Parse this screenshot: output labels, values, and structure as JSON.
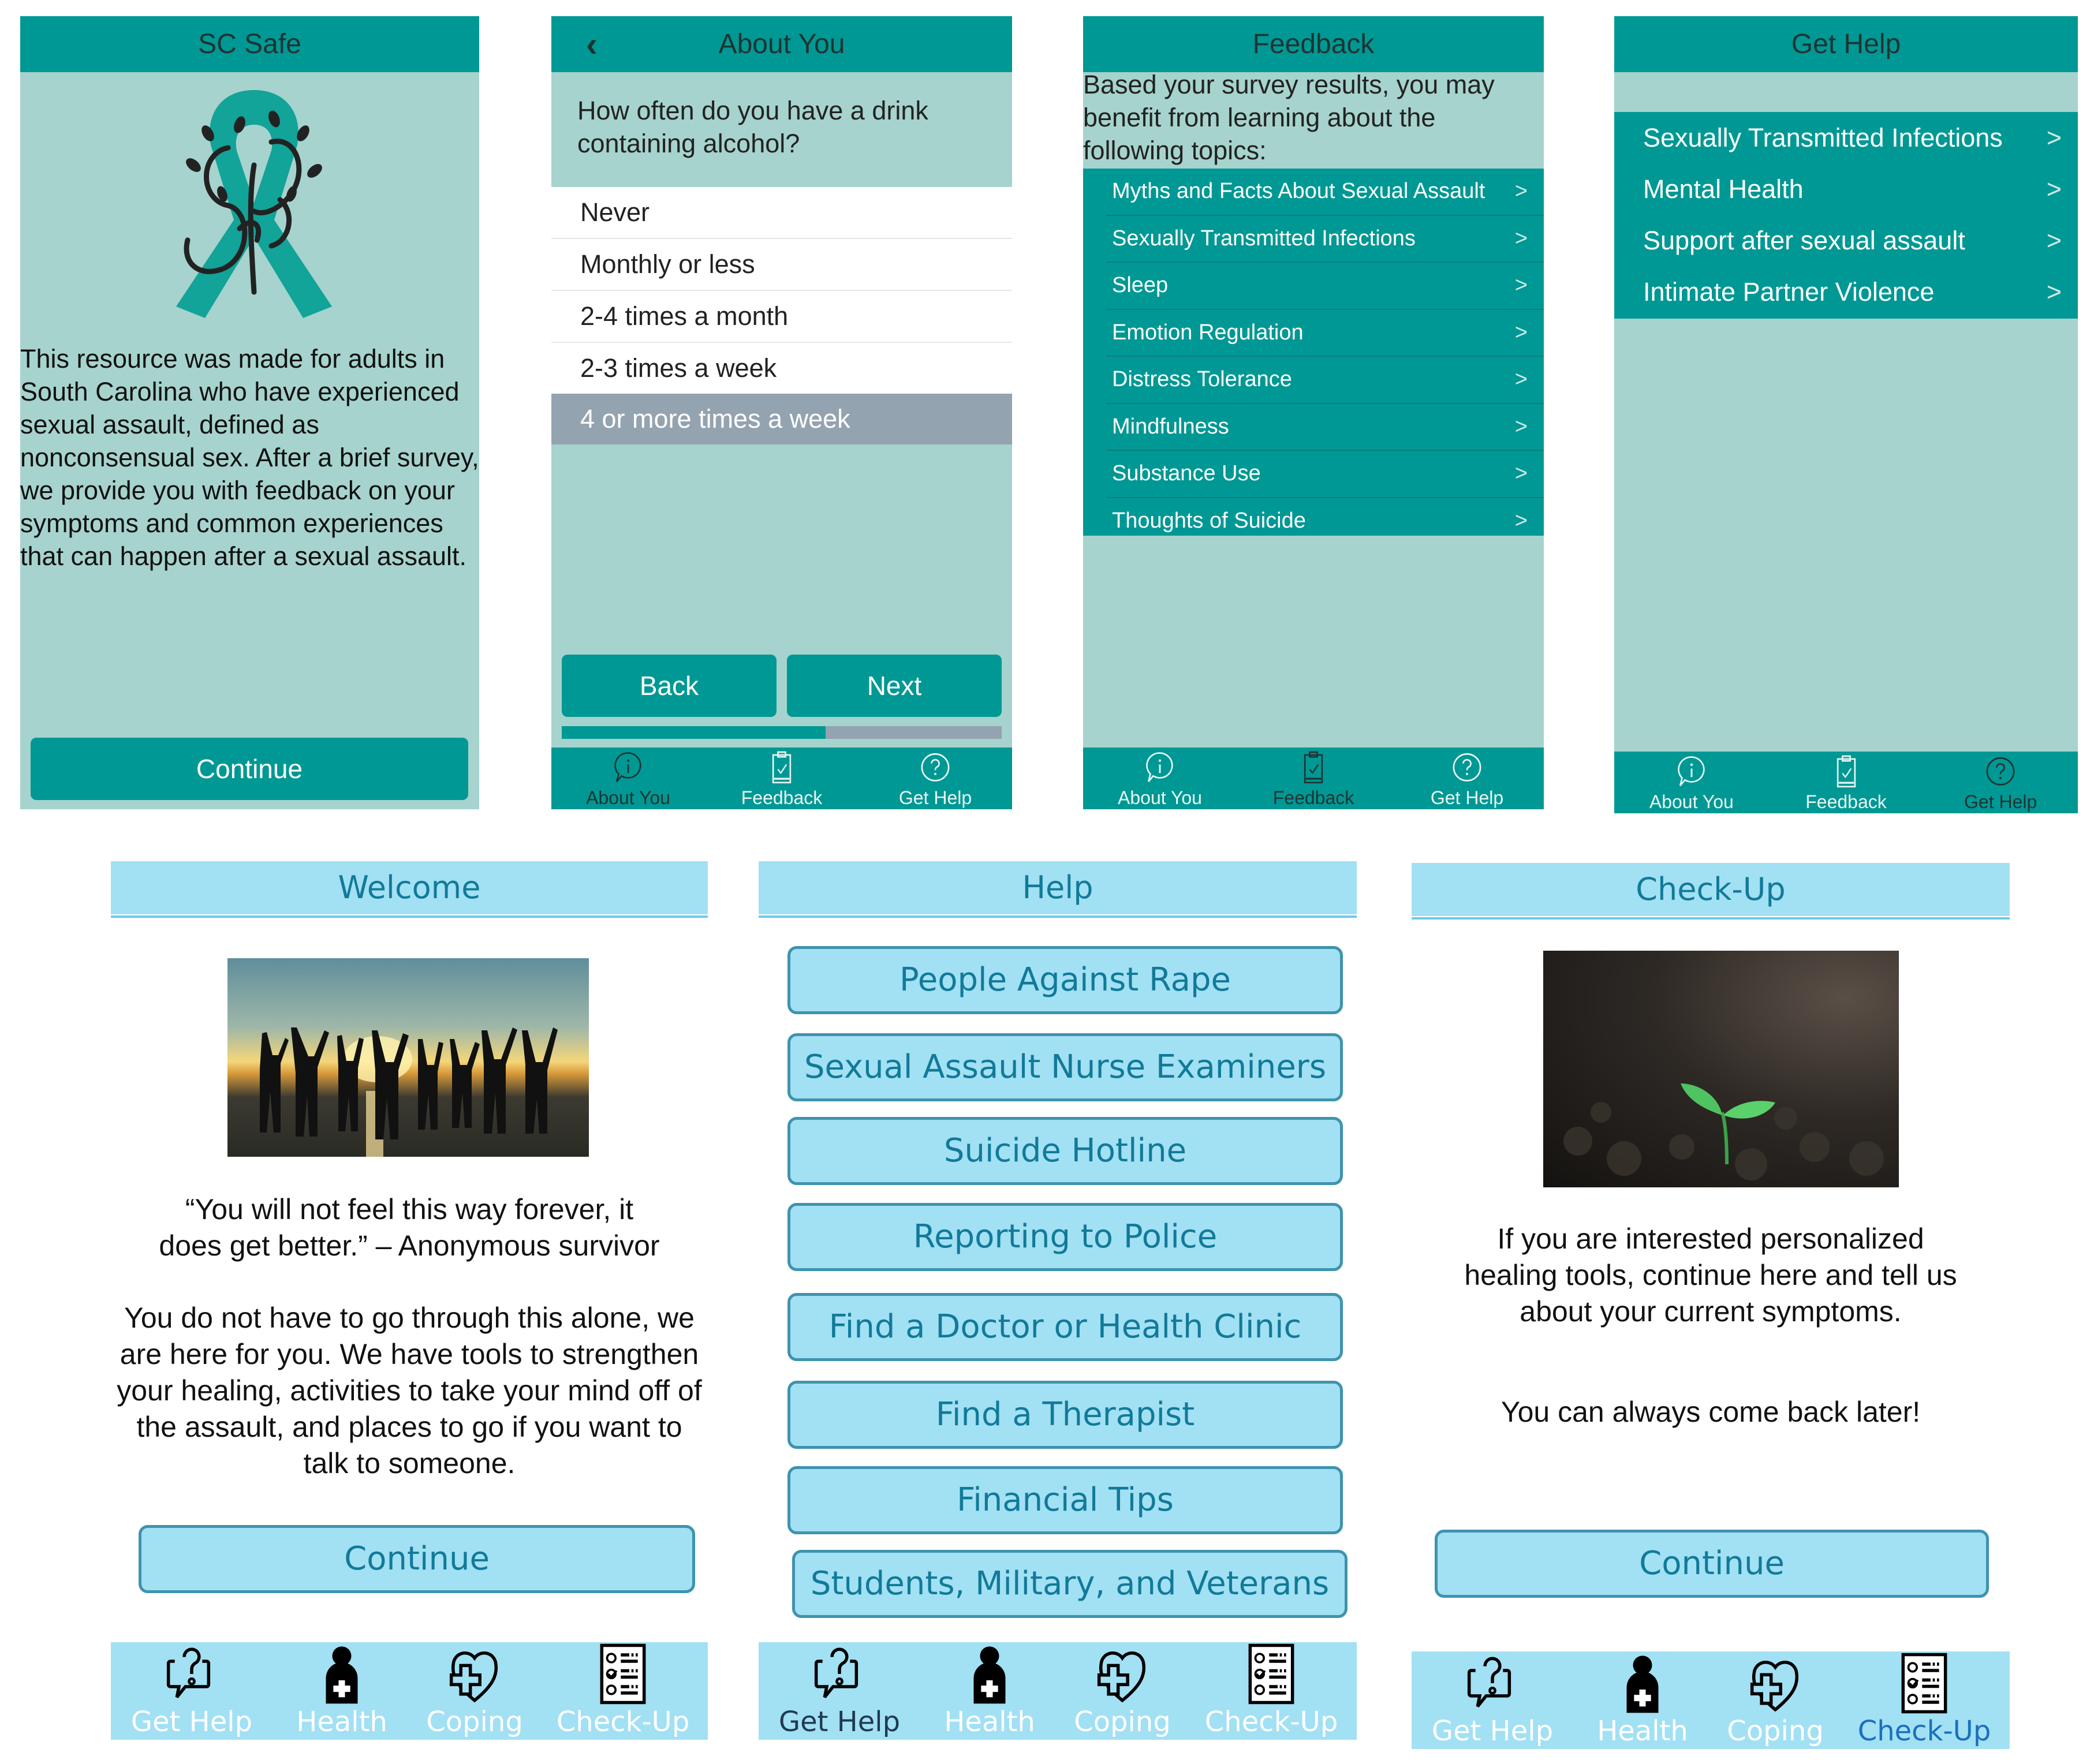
{
  "colors": {
    "teal_primary": "#009894",
    "teal_light_bg": "#a6d3cd",
    "selected_row": "#94a3b0",
    "progress_track": "#94a3b0",
    "blue_light": "#a2e0f4",
    "blue_text": "#117a98",
    "blue_border": "#3f93ae",
    "active_tab_dark": "#1e3432",
    "active_tab_blue": "#1a6fbd"
  },
  "sc_safe_screen": {
    "title": "SC Safe",
    "logo": "teal-ribbon-safe-logo",
    "description": "This resource was made for adults in South Carolina who have experienced sexual assault, defined as nonconsensual sex. After a brief survey, we provide you with feedback on your symptoms and common experiences that can happen after a sexual assault.",
    "continue_label": "Continue"
  },
  "about_you_screen": {
    "title": "About You",
    "back_icon": "chevron-left-icon",
    "question": "How often do you have a drink containing alcohol?",
    "options": [
      {
        "label": "Never",
        "selected": false
      },
      {
        "label": "Monthly or less",
        "selected": false
      },
      {
        "label": "2-4 times a month",
        "selected": false
      },
      {
        "label": "2-3 times a week",
        "selected": false
      },
      {
        "label": "4 or more times a week",
        "selected": true
      }
    ],
    "back_label": "Back",
    "next_label": "Next",
    "progress": 0.6,
    "tabs": [
      {
        "label": "About You",
        "icon": "info-bubble-icon",
        "active": true
      },
      {
        "label": "Feedback",
        "icon": "clipboard-check-icon",
        "active": false
      },
      {
        "label": "Get Help",
        "icon": "question-circle-icon",
        "active": false
      }
    ]
  },
  "feedback_screen": {
    "title": "Feedback",
    "intro": "Based your survey results, you may benefit from learning about the following topics:",
    "topics": [
      "Myths and Facts About Sexual Assault",
      "Sexually Transmitted Infections",
      "Sleep",
      "Emotion Regulation",
      "Distress Tolerance",
      "Mindfulness",
      "Substance Use",
      "Thoughts of Suicide"
    ],
    "chevron": ">",
    "tabs": [
      {
        "label": "About You",
        "icon": "info-bubble-icon",
        "active": false
      },
      {
        "label": "Feedback",
        "icon": "clipboard-check-icon",
        "active": true
      },
      {
        "label": "Get Help",
        "icon": "question-circle-icon",
        "active": false
      }
    ]
  },
  "get_help_screen": {
    "title": "Get Help",
    "items": [
      "Sexually Transmitted Infections",
      "Mental Health",
      "Support after sexual assault",
      "Intimate Partner Violence"
    ],
    "chevron": ">",
    "tabs": [
      {
        "label": "About You",
        "icon": "info-bubble-icon",
        "active": false
      },
      {
        "label": "Feedback",
        "icon": "clipboard-check-icon",
        "active": false
      },
      {
        "label": "Get Help",
        "icon": "question-circle-icon",
        "active": true
      }
    ]
  },
  "welcome_screen": {
    "title": "Welcome",
    "image": "silhouettes-of-people-raising-hands-at-sunset-beach",
    "quote": "“You will not feel this way forever, it does get better.” – Anonymous survivor",
    "message": "You do not have to go through this alone, we are here for you. We have tools to strengthen your healing, activities to take your mind off of the assault, and places to go if you want to talk to someone.",
    "continue_label": "Continue",
    "tabs": [
      {
        "label": "Get Help",
        "icon": "question-speech-bubble-icon",
        "active": false
      },
      {
        "label": "Health",
        "icon": "person-medical-cross-icon",
        "active": false
      },
      {
        "label": "Coping",
        "icon": "heart-cross-icon",
        "active": false
      },
      {
        "label": "Check-Up",
        "icon": "checklist-icon",
        "active": false
      }
    ]
  },
  "help_screen": {
    "title": "Help",
    "buttons": [
      "People Against Rape",
      "Sexual Assault Nurse Examiners",
      "Suicide Hotline",
      "Reporting to Police",
      "Find a Doctor or Health Clinic",
      "Find a Therapist",
      "Financial Tips",
      "Students, Military, and Veterans"
    ],
    "tabs": [
      {
        "label": "Get Help",
        "icon": "question-speech-bubble-icon",
        "active": true
      },
      {
        "label": "Health",
        "icon": "person-medical-cross-icon",
        "active": false
      },
      {
        "label": "Coping",
        "icon": "heart-cross-icon",
        "active": false
      },
      {
        "label": "Check-Up",
        "icon": "checklist-icon",
        "active": false
      }
    ]
  },
  "checkup_screen": {
    "title": "Check-Up",
    "image": "green-seedling-sprouting-from-dark-soil",
    "message": "If you are interested personalized healing tools, continue here and tell us about your current symptoms.",
    "note": "You can always come back later!",
    "continue_label": "Continue",
    "tabs": [
      {
        "label": "Get Help",
        "icon": "question-speech-bubble-icon",
        "active": false
      },
      {
        "label": "Health",
        "icon": "person-medical-cross-icon",
        "active": false
      },
      {
        "label": "Coping",
        "icon": "heart-cross-icon",
        "active": false
      },
      {
        "label": "Check-Up",
        "icon": "checklist-icon",
        "active": true
      }
    ]
  }
}
